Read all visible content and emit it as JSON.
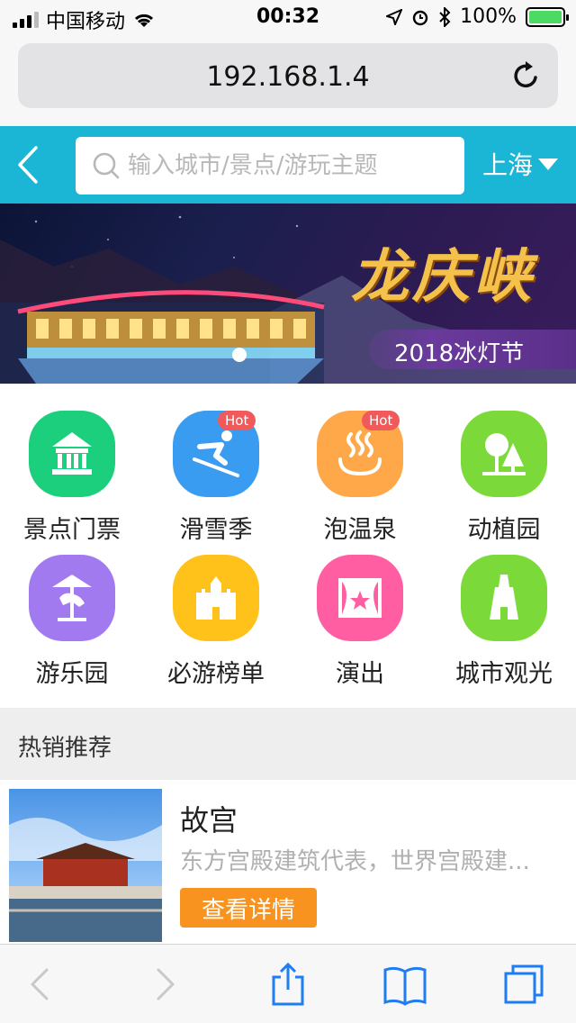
{
  "status_bar": {
    "carrier": "中国移动",
    "time": "00:32",
    "battery_text": "100%",
    "icons": [
      "signal-icon",
      "wifi-icon",
      "location-icon",
      "alarm-icon",
      "bluetooth-icon",
      "battery-icon"
    ]
  },
  "browser": {
    "url": "192.168.1.4"
  },
  "header": {
    "search_placeholder": "输入城市/景点/游玩主题",
    "city": "上海",
    "accent": "#1bb6d6"
  },
  "banner": {
    "title": "龙庆峡",
    "subtitle": "2018冰灯节"
  },
  "categories": [
    {
      "label": "景点门票",
      "icon": "pavilion-icon",
      "color": "#1ccf7c"
    },
    {
      "label": "滑雪季",
      "icon": "skier-icon",
      "color": "#3a9cf0",
      "badge": "Hot"
    },
    {
      "label": "泡温泉",
      "icon": "hot-spring-icon",
      "color": "#ffa84a",
      "badge": "Hot"
    },
    {
      "label": "动植园",
      "icon": "tree-icon",
      "color": "#7bd93a"
    },
    {
      "label": "游乐园",
      "icon": "carousel-icon",
      "color": "#a17af0"
    },
    {
      "label": "必游榜单",
      "icon": "castle-icon",
      "color": "#ffc21a"
    },
    {
      "label": "演出",
      "icon": "stage-icon",
      "color": "#ff5fa2"
    },
    {
      "label": "城市观光",
      "icon": "tower-icon",
      "color": "#7bd93a"
    }
  ],
  "section": {
    "title": "热销推荐"
  },
  "hot_item": {
    "name": "故宫",
    "description": "东方宫殿建筑代表，世界宫殿建...",
    "button": "查看详情",
    "button_color": "#f7931e"
  }
}
